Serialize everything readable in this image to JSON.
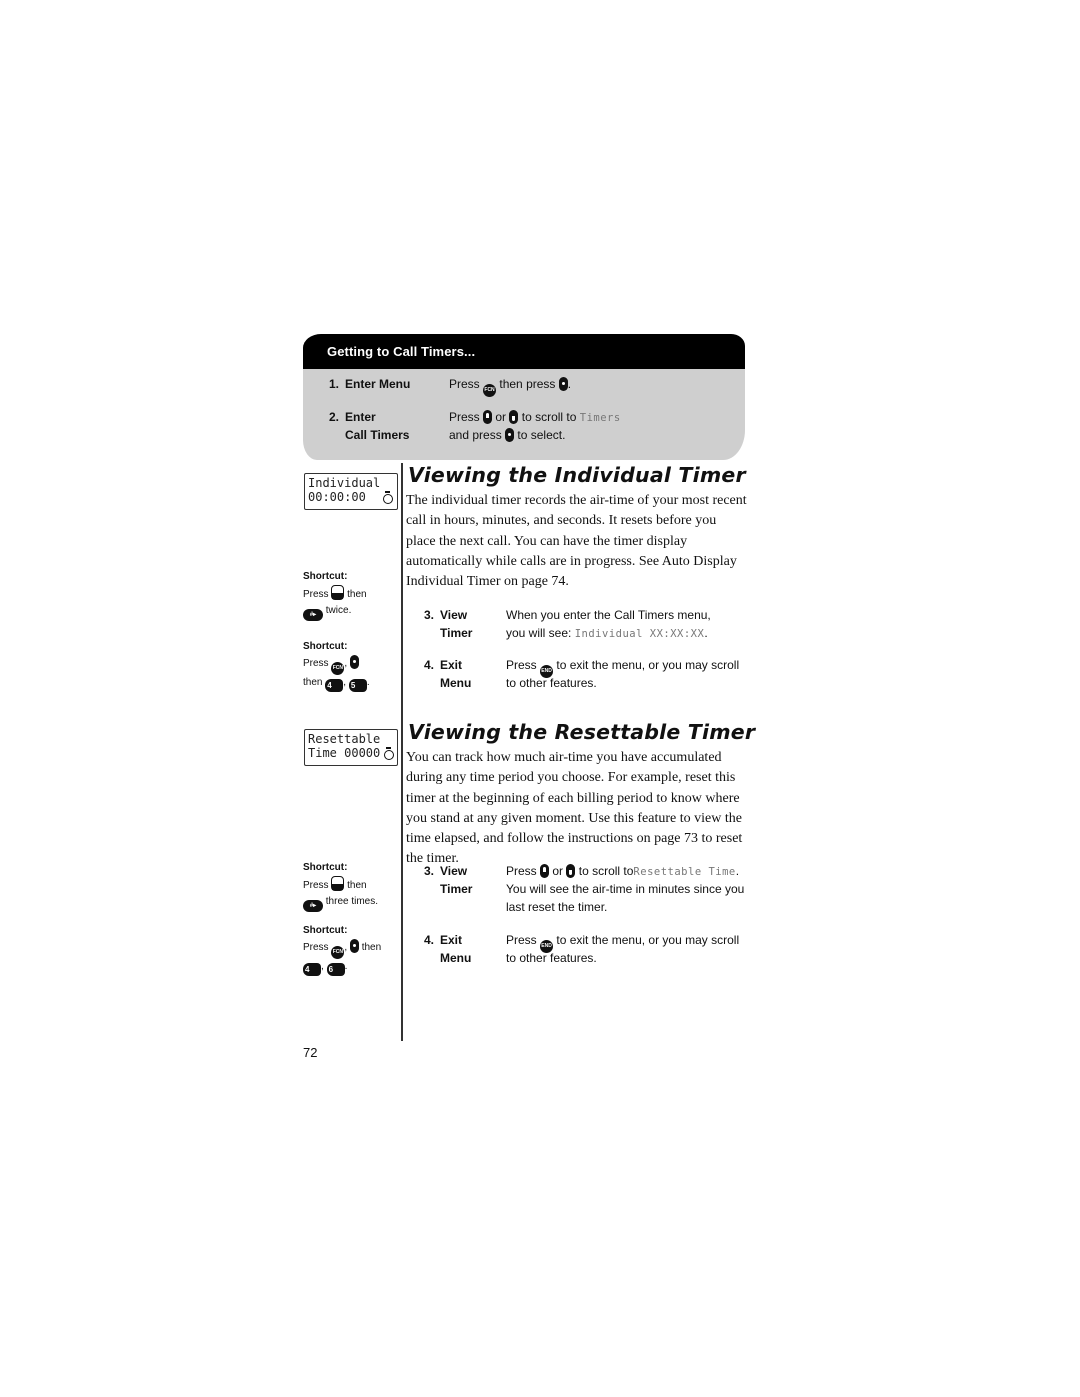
{
  "box": {
    "title": "Getting to Call Timers...",
    "steps": [
      {
        "num": "1.",
        "label1": "Enter Menu",
        "label2": "",
        "t1a": "Press",
        "t1b": "then press",
        "t1c": ".",
        "t2": ""
      },
      {
        "num": "2.",
        "label1": "Enter",
        "label2": "Call Timers",
        "t1a": "Press",
        "t1b": "or",
        "t1c": "to scroll to",
        "lcd": "Timers",
        "t2a": "and press",
        "t2b": "to select."
      }
    ]
  },
  "individual": {
    "lcd_line1": "Individual",
    "lcd_line2": "00:00:00",
    "heading": "Viewing the Individual Timer",
    "body": "The individual timer records the air-time of your most recent call in hours, minutes, and seconds. It resets before you place the next call. You can have the timer display automatically while calls are in progress. See Auto Display Individual Timer on page 74.",
    "shortcuts": [
      {
        "label": "Shortcut:",
        "a": "Press",
        "b": "then",
        "c": "twice."
      },
      {
        "label": "Shortcut:",
        "a": "Press",
        "b": ",",
        "c": "then",
        "d": ","
      }
    ],
    "steps": [
      {
        "num": "3.",
        "l1": "View",
        "l2": "Timer",
        "t1": "When you enter the Call Timers menu,",
        "t2a": "you will see:",
        "lcd": "Individual XX:XX:XX",
        "t2b": "."
      },
      {
        "num": "4.",
        "l1": "Exit",
        "l2": "Menu",
        "t1a": "Press",
        "t1b": "to exit the menu, or you may scroll",
        "t2": "to other features."
      }
    ]
  },
  "resettable": {
    "lcd_line1": "Resettable",
    "lcd_line2": "Time 00000",
    "heading": "Viewing the Resettable Timer",
    "body": "You can track how much air-time you have accumulated during any time period you choose. For example, reset this timer at the beginning of each billing period to know where you stand at any given moment. Use this feature to view the time elapsed, and follow the instructions on page 73 to reset the timer.",
    "shortcuts": [
      {
        "label": "Shortcut:",
        "a": "Press",
        "b": "then",
        "c": "three times."
      },
      {
        "label": "Shortcut:",
        "a": "Press",
        "b": ",",
        "c": "then",
        "d": ",",
        "e": "."
      }
    ],
    "steps": [
      {
        "num": "3.",
        "l1": "View",
        "l2": "Timer",
        "t1a": "Press",
        "t1b": "or",
        "t1c": "to scroll to",
        "lcd": "Resettable Time",
        "t1d": ".",
        "t2": "You will see the air-time in minutes since you",
        "t3": "last reset the timer."
      },
      {
        "num": "4.",
        "l1": "Exit",
        "l2": "Menu",
        "t1a": "Press",
        "t1b": "to exit the menu, or you may scroll",
        "t2": "to other features."
      }
    ]
  },
  "keys": {
    "fcn": "FCN",
    "end": "END",
    "hash": "#▸",
    "k4": "4",
    "k5": "5",
    "k6": "6"
  },
  "page_number": "72"
}
